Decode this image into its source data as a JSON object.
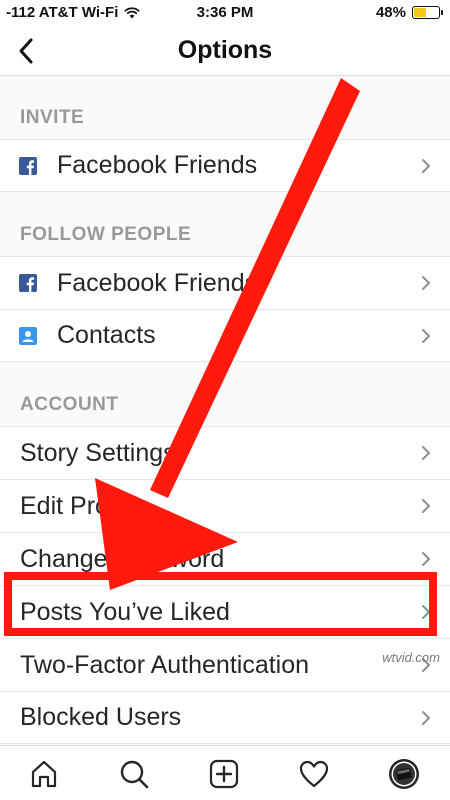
{
  "status_bar": {
    "carrier": "-112 AT&T Wi-Fi",
    "time": "3:36 PM",
    "battery": "48%",
    "battery_level": 0.48
  },
  "nav": {
    "title": "Options",
    "back_icon": "chevron-left-icon"
  },
  "sections": {
    "invite": {
      "header": "INVITE",
      "items": [
        {
          "label": "Facebook Friends",
          "icon": "facebook-icon"
        }
      ]
    },
    "follow": {
      "header": "FOLLOW PEOPLE",
      "items": [
        {
          "label": "Facebook Friends",
          "icon": "facebook-icon"
        },
        {
          "label": "Contacts",
          "icon": "contacts-icon"
        }
      ]
    },
    "account": {
      "header": "ACCOUNT",
      "items": [
        {
          "label": "Story Settings"
        },
        {
          "label": "Edit Profile"
        },
        {
          "label": "Change Password"
        },
        {
          "label": "Posts You’ve Liked"
        },
        {
          "label": "Two-Factor Authentication"
        },
        {
          "label": "Blocked Users"
        }
      ]
    }
  },
  "tab_bar": {
    "tabs": [
      "home-icon",
      "search-icon",
      "new-post-icon",
      "activity-heart-icon",
      "profile-avatar-icon"
    ]
  },
  "annotation": {
    "arrow_color": "#ff1a0d",
    "watermark": "wtvid.com"
  },
  "colors": {
    "facebook": "#3b5998",
    "contacts": "#3897f0",
    "highlight": "#ff1a0d"
  }
}
